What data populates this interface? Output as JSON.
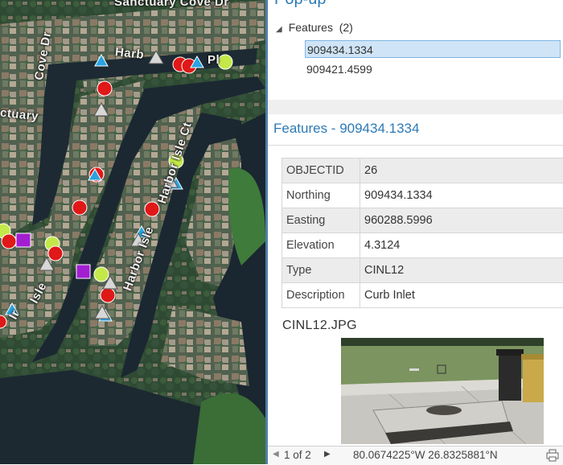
{
  "map": {
    "labels": {
      "sanctuary_cove_dr_top": "Sanctuary Cove Dr",
      "cove_dr": "Cove Dr",
      "sanctuary_left": "ctuary",
      "harbor_top": "Harb",
      "harbor_pl": "Pl",
      "harbor_isle_mid": "Harbor Isle Ct",
      "harbor_isle_lower": "Harbor Isle",
      "isle_left": "Isle",
      "isle_left_prefix": "Ir"
    }
  },
  "popup": {
    "title": "Pop-up",
    "tree": {
      "header": "Features",
      "count": "(2)",
      "items": [
        "909434.1334",
        "909421.4599"
      ]
    },
    "section_title": "Features - 909434.1334",
    "attributes": [
      {
        "key": "OBJECTID",
        "value": "26"
      },
      {
        "key": "Northing",
        "value": "909434.1334"
      },
      {
        "key": "Easting",
        "value": "960288.5996"
      },
      {
        "key": "Elevation",
        "value": "4.3124"
      },
      {
        "key": "Type",
        "value": "CINL12"
      },
      {
        "key": "Description",
        "value": "Curb Inlet"
      }
    ],
    "image_caption": "CINL12.JPG",
    "status": {
      "pager": "1 of 2",
      "coordinates": "80.0674225°W 26.8325881°N"
    }
  },
  "colors": {
    "accent": "#2d7ab5",
    "selected_bg": "#cfe5f7",
    "point_yellow": "#c4e84a",
    "point_red": "#e01818",
    "point_blue": "#2aa3e0",
    "point_purple": "#a21fd1"
  }
}
